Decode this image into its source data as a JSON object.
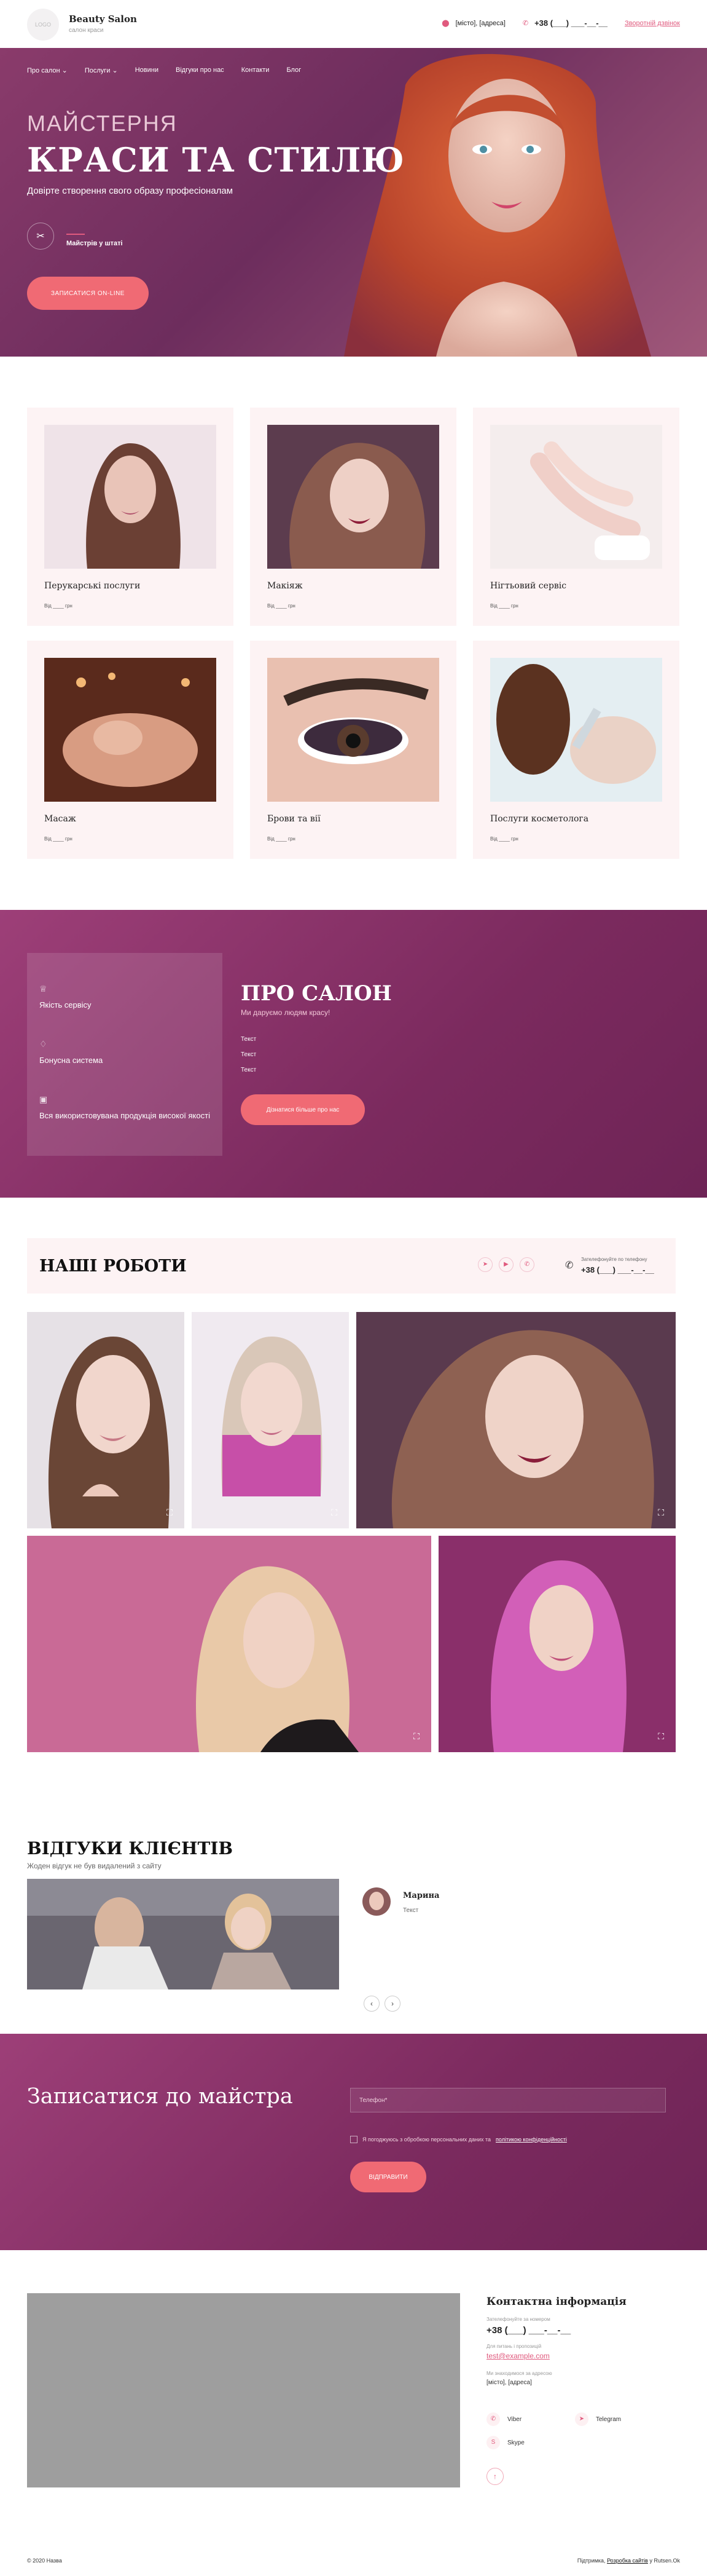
{
  "header": {
    "logo_text": "LOGO",
    "brand_name": "Beauty Salon",
    "brand_sub": "салон краси",
    "address": "[місто], [адреса]",
    "phone": "+38 (___) ___-__-__",
    "callback": "Зворотній дзвінок"
  },
  "nav": [
    "Про салон",
    "Послуги",
    "Новини",
    "Відгуки про нас",
    "Контакти",
    "Блог"
  ],
  "hero": {
    "pre_title": "МАЙСТЕРНЯ",
    "title": "КРАСИ ТА СТИЛЮ",
    "subtitle": "Довірте створення свого образу професіоналам",
    "masters_label": "Майстрів у штаті",
    "button": "ЗАПИСАТИСЯ ON-LINE"
  },
  "services": [
    {
      "name": "Перукарські послуги",
      "price": "Від ____ грн"
    },
    {
      "name": "Макіяж",
      "price": "Від ____ грн"
    },
    {
      "name": "Нігтьовий сервіс",
      "price": "Від ____ грн"
    },
    {
      "name": "Масаж",
      "price": "Від ____ грн"
    },
    {
      "name": "Брови та вії",
      "price": "Від ____ грн"
    },
    {
      "name": "Послуги косметолога",
      "price": "Від ____ грн"
    }
  ],
  "about": {
    "features": [
      "Якість сервісу",
      "Бонусна система",
      "Вся використовувана продукція високої якості"
    ],
    "title": "ПРО САЛОН",
    "subtitle": "Ми даруємо людям красу!",
    "texts": [
      "Текст",
      "Текст",
      "Текст"
    ],
    "button": "Дізнатися більше про нас"
  },
  "works": {
    "title": "НАШІ РОБОТИ",
    "phone_label": "Зателефонуйте по телефону",
    "phone": "+38 (___) ___-__-__",
    "social": [
      "telegram-icon",
      "youtube-icon",
      "whatsapp-icon"
    ]
  },
  "reviews": {
    "title": "ВІДГУКИ КЛІЄНТІВ",
    "subtitle": "Жоден відгук не був видалений з сайту",
    "name": "Марина",
    "text": "Текст"
  },
  "signup": {
    "title": "Записатися до майстра",
    "placeholder": "Телефон*",
    "consent": "Я погоджуюсь з обробкою персональних даних та",
    "consent_link": "політикою конфіденційності",
    "button": "ВІДПРАВИТИ"
  },
  "contacts": {
    "title": "Контактна інформація",
    "phone_label": "Зателефонуйте за номером",
    "phone": "+38 (___) ___-__-__",
    "email_label": "Для питань і пропозицій",
    "email": "test@example.com",
    "address_label": "Ми знаходимося за адресою",
    "address": "[місто], [адреса]",
    "messengers": [
      "Viber",
      "Telegram",
      "Skype"
    ]
  },
  "footer": {
    "copyright": "© 2020 Назва",
    "powered": "Підтримка,",
    "dev_link": "Розробка сайтів",
    "dev_suffix": "у Rutsen.Ok"
  },
  "colors": {
    "accent": "#f06a74",
    "brand": "#8a3b6b",
    "card_bg": "#fdf3f4"
  }
}
